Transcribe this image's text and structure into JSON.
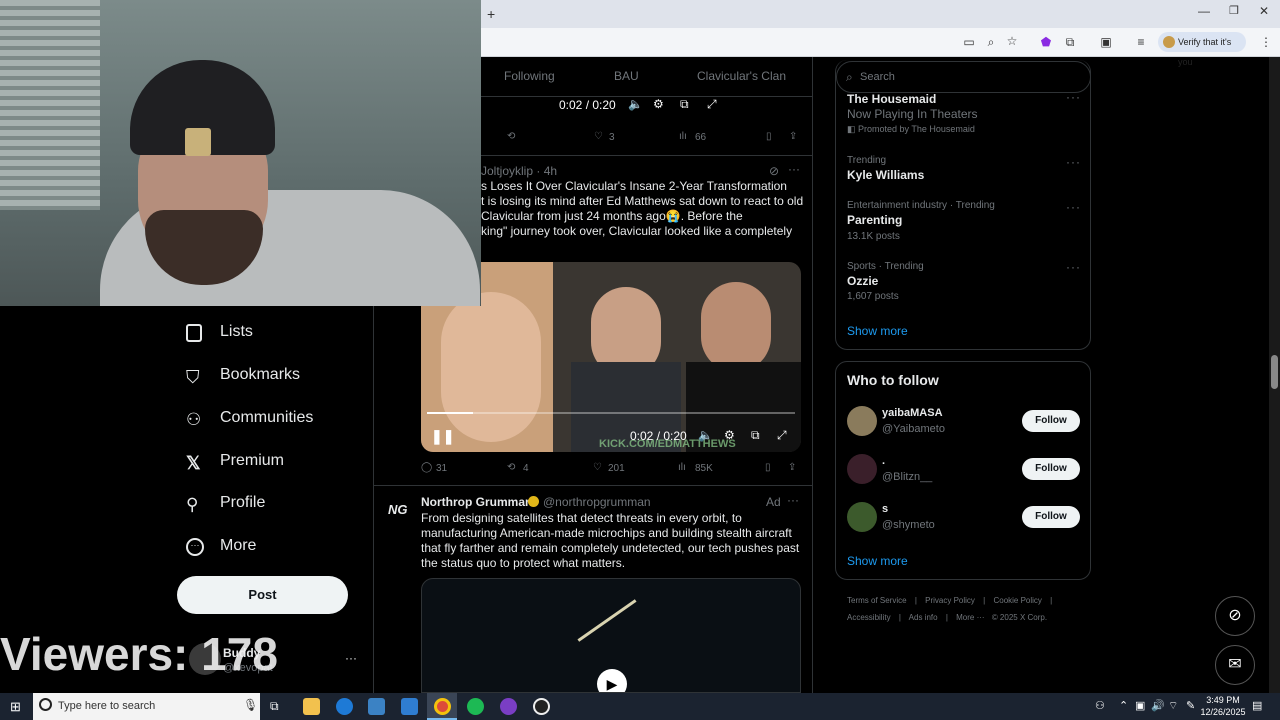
{
  "browser": {
    "new_tab_label": "+",
    "verify_label": "Verify that it's you"
  },
  "tabs": [
    "Following",
    "BAU",
    "Clavicular's Clan"
  ],
  "top_video": {
    "time": "0:02 / 0:20"
  },
  "post1_actions": {
    "likes": "3",
    "views": "66"
  },
  "post2": {
    "author": "Joltjoyklip",
    "time": "· 4h",
    "lines": [
      "s Loses It Over Clavicular's Insane 2-Year Transformation",
      "t is losing its mind after Ed Matthews sat down to react to old",
      "Clavicular from just 24 months ago😭. Before the",
      "king\" journey took over, Clavicular looked like a completely"
    ],
    "video_time": "0:02 / 0:20",
    "watermark": "KICK.COM/EDMATTHEWS",
    "replies": "31",
    "reposts": "4",
    "likes": "201",
    "views": "85K"
  },
  "ad": {
    "author": "Northrop Grumman",
    "handle": "@northropgrumman",
    "badge": "Ad",
    "logo": "NG",
    "lines": [
      "From designing satellites that detect threats in every orbit, to",
      "manufacturing American-made microchips and building stealth aircraft",
      "that fly farther and remain completely undetected, our tech pushes past",
      "the status quo to protect what matters."
    ]
  },
  "search": {
    "placeholder": "Search"
  },
  "trends": {
    "promoted_title": "The Housemaid",
    "promoted_sub": "Now Playing In Theaters",
    "promoted_by": "Promoted by The Housemaid",
    "items": [
      {
        "meta": "Trending",
        "name": "Kyle Williams",
        "count": ""
      },
      {
        "meta": "Entertainment industry · Trending",
        "name": "Parenting",
        "count": "13.1K posts"
      },
      {
        "meta": "Sports · Trending",
        "name": "Ozzie",
        "count": "1,607 posts"
      }
    ],
    "show_more": "Show more"
  },
  "who_to_follow": {
    "title": "Who to follow",
    "users": [
      {
        "name": "yaibaMASA",
        "handle": "@Yaibameto",
        "button": "Follow"
      },
      {
        "name": ".",
        "handle": "@Blitzn__",
        "button": "Follow"
      },
      {
        "name": "s",
        "handle": "@shymeto",
        "button": "Follow"
      }
    ],
    "show_more": "Show more"
  },
  "footer": {
    "row1": [
      "Terms of Service",
      "Privacy Policy",
      "Cookie Policy"
    ],
    "row2": [
      "Accessibility",
      "Ads info",
      "More ···",
      "© 2025 X Corp."
    ]
  },
  "nav": [
    "Lists",
    "Bookmarks",
    "Communities",
    "Premium",
    "Profile",
    "More"
  ],
  "post_button": "Post",
  "account": {
    "name": "Buddy",
    "handle": "@xevopat"
  },
  "overlay": {
    "viewers": "Viewers: 178"
  },
  "taskbar": {
    "search_placeholder": "Type here to search",
    "time": "3:49 PM",
    "date": "12/26/2025"
  },
  "colors": {
    "background": "#000000",
    "accent": "#1d9bf0",
    "text": "#e7e9ea",
    "muted": "#71767b",
    "border": "#2f3336"
  }
}
